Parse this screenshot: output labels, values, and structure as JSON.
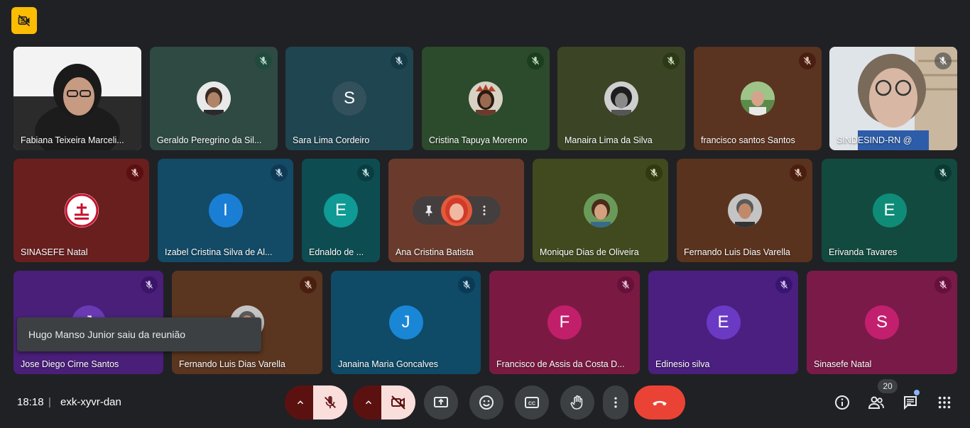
{
  "meeting": {
    "time": "18:18",
    "separator": "|",
    "code": "exk-xyvr-dan",
    "participant_count": "20"
  },
  "toast": {
    "text": "Hugo Manso Junior saiu da reunião"
  },
  "icons": {
    "camera_off": "camera-off-icon",
    "mic_off": "mic-off-icon",
    "pin": "pin-icon",
    "more": "more-vert-icon",
    "chevron_up": "chevron-up-icon",
    "present": "present-screen-icon",
    "emoji": "emoji-icon",
    "captions": "closed-captions-icon",
    "hand": "raise-hand-icon",
    "leave": "call-end-icon",
    "info": "info-icon",
    "people": "people-icon",
    "chat": "chat-icon",
    "apps": "apps-grid-icon"
  },
  "controls": {
    "captions_label": "CC"
  },
  "colors": {
    "accent_yellow": "#fbbc04",
    "leave_red": "#ea4335",
    "muted_pill": "#f9dedc"
  },
  "tiles": [
    {
      "name": "Fabiana Teixeira Marceli...",
      "bg": "#3a3a3a",
      "type": "video",
      "muted": false
    },
    {
      "name": "Geraldo Peregrino da Sil...",
      "bg": "#2e4a43",
      "type": "photo",
      "muted": true,
      "mic_bg": "#1f4a3c"
    },
    {
      "name": "Sara Lima Cordeiro",
      "bg": "#1f4550",
      "type": "letter",
      "letter": "S",
      "avatar_bg": "#33515c",
      "muted": true,
      "mic_bg": "#153a46"
    },
    {
      "name": "Cristina Tapuya Morenno",
      "bg": "#2c4a2c",
      "type": "photo",
      "muted": true,
      "mic_bg": "#1b3e1f"
    },
    {
      "name": "Manaira Lima da Silva",
      "bg": "#3b4526",
      "type": "photo",
      "muted": true,
      "mic_bg": "#2b3a15"
    },
    {
      "name": "francisco santos Santos",
      "bg": "#5a3420",
      "type": "photo",
      "muted": true,
      "mic_bg": "#4a1f12"
    },
    {
      "name": "SINDESIND-RN @",
      "bg": "#8b97a5",
      "type": "video",
      "muted": true
    },
    {
      "name": "SINASEFE Natal",
      "bg": "#6a1f1f",
      "type": "logo",
      "muted": true,
      "mic_bg": "#5a0f10"
    },
    {
      "name": "Izabel Cristina Silva de Al...",
      "bg": "#134a66",
      "type": "letter",
      "letter": "I",
      "avatar_bg": "#1a7fd4",
      "muted": true,
      "mic_bg": "#0e3a55"
    },
    {
      "name": "Ednaldo de ...",
      "bg": "#0d4d52",
      "type": "letter",
      "letter": "E",
      "avatar_bg": "#0f9a95",
      "muted": true,
      "mic_bg": "#093d42"
    },
    {
      "name": "Ana Cristina Batista",
      "bg": "#6a3b2c",
      "type": "pinned",
      "muted": false
    },
    {
      "name": "Monique Dias de Oliveira",
      "bg": "#404a1e",
      "type": "photo",
      "muted": true,
      "mic_bg": "#2f3a10"
    },
    {
      "name": "Fernando Luis Dias Varella",
      "bg": "#5a331e",
      "type": "photo",
      "muted": true,
      "mic_bg": "#4a1f10"
    },
    {
      "name": "Erivanda Tavares",
      "bg": "#134a40",
      "type": "letter",
      "letter": "E",
      "avatar_bg": "#0f8c77",
      "muted": true,
      "mic_bg": "#0a3a32"
    },
    {
      "name": "Jose Diego Cirne Santos",
      "bg": "#4a1f7a",
      "type": "letter",
      "letter": "J",
      "avatar_bg": "#6a3ab5",
      "muted": true,
      "mic_bg": "#3a1568"
    },
    {
      "name": "Fernando Luis Dias Varella",
      "bg": "#5a3520",
      "type": "photo",
      "muted": true,
      "mic_bg": "#4a1f10"
    },
    {
      "name": "Janaina Maria Goncalves",
      "bg": "#0f4a66",
      "type": "letter",
      "letter": "J",
      "avatar_bg": "#1a86d6",
      "muted": true,
      "mic_bg": "#0a3a55"
    },
    {
      "name": "Francisco de Assis da Costa D...",
      "bg": "#7a1a42",
      "type": "letter",
      "letter": "F",
      "avatar_bg": "#c21f6b",
      "muted": true,
      "mic_bg": "#66103a"
    },
    {
      "name": "Edinesio silva",
      "bg": "#4a1f80",
      "type": "letter",
      "letter": "E",
      "avatar_bg": "#6a3ac4",
      "muted": true,
      "mic_bg": "#3a1570"
    },
    {
      "name": "Sinasefe Natal",
      "bg": "#7a1a48",
      "type": "letter",
      "letter": "S",
      "avatar_bg": "#c2206f",
      "muted": true,
      "mic_bg": "#66103d"
    }
  ]
}
